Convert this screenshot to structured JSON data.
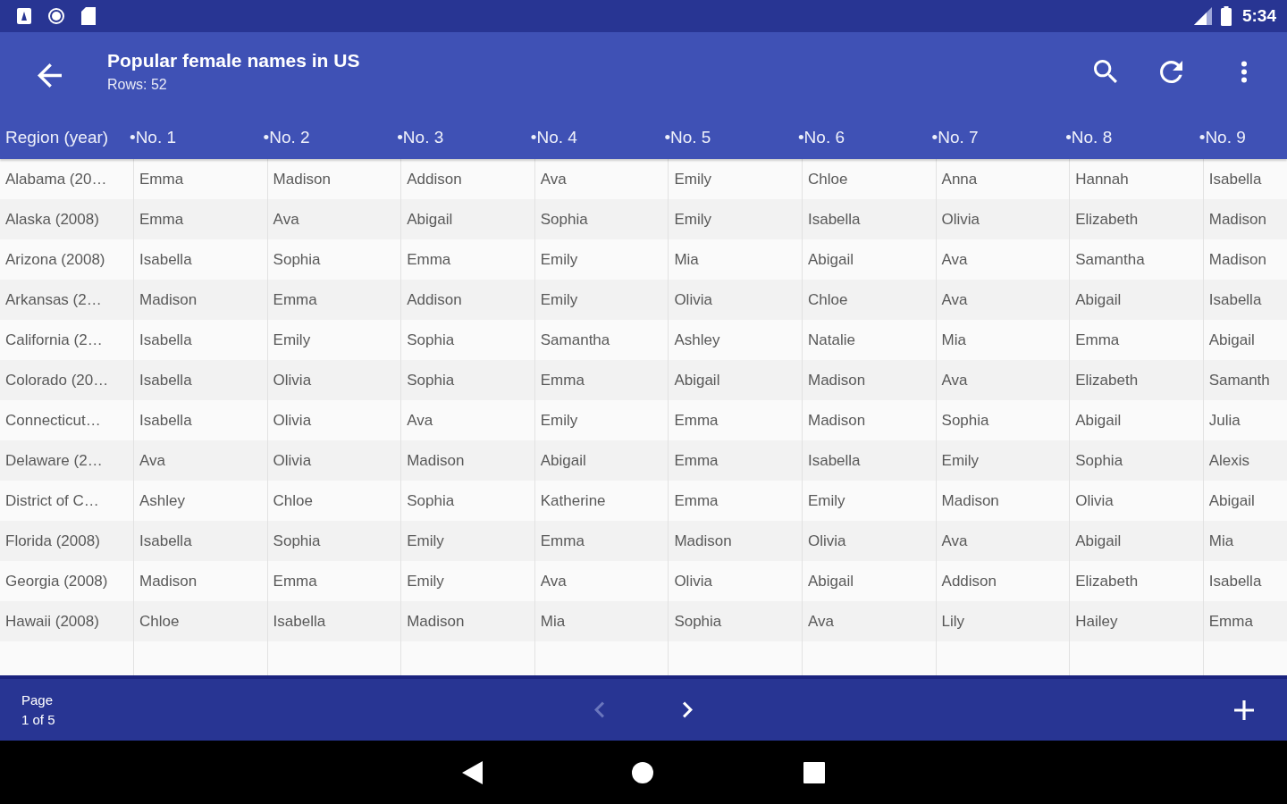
{
  "status_bar": {
    "time": "5:34"
  },
  "app_bar": {
    "title": "Popular female names in US",
    "subtitle": "Rows: 52"
  },
  "table": {
    "columns": [
      "Region (year)",
      "•No. 1",
      "•No. 2",
      "•No. 3",
      "•No. 4",
      "•No. 5",
      "•No. 6",
      "•No. 7",
      "•No. 8",
      "•No. 9"
    ],
    "rows": [
      [
        "Alabama (20…",
        "Emma",
        "Madison",
        "Addison",
        "Ava",
        "Emily",
        "Chloe",
        "Anna",
        "Hannah",
        "Isabella"
      ],
      [
        "Alaska (2008)",
        "Emma",
        "Ava",
        "Abigail",
        "Sophia",
        "Emily",
        "Isabella",
        "Olivia",
        "Elizabeth",
        "Madison"
      ],
      [
        "Arizona (2008)",
        "Isabella",
        "Sophia",
        "Emma",
        "Emily",
        "Mia",
        "Abigail",
        "Ava",
        "Samantha",
        "Madison"
      ],
      [
        "Arkansas (2…",
        "Madison",
        "Emma",
        "Addison",
        "Emily",
        "Olivia",
        "Chloe",
        "Ava",
        "Abigail",
        "Isabella"
      ],
      [
        "California (2…",
        "Isabella",
        "Emily",
        "Sophia",
        "Samantha",
        "Ashley",
        "Natalie",
        "Mia",
        "Emma",
        "Abigail"
      ],
      [
        "Colorado (20…",
        "Isabella",
        "Olivia",
        "Sophia",
        "Emma",
        "Abigail",
        "Madison",
        "Ava",
        "Elizabeth",
        "Samanth"
      ],
      [
        "Connecticut…",
        "Isabella",
        "Olivia",
        "Ava",
        "Emily",
        "Emma",
        "Madison",
        "Sophia",
        "Abigail",
        "Julia"
      ],
      [
        "Delaware (2…",
        "Ava",
        "Olivia",
        "Madison",
        "Abigail",
        "Emma",
        "Isabella",
        "Emily",
        "Sophia",
        "Alexis"
      ],
      [
        "District of C…",
        "Ashley",
        "Chloe",
        "Sophia",
        "Katherine",
        "Emma",
        "Emily",
        "Madison",
        "Olivia",
        "Abigail"
      ],
      [
        "Florida (2008)",
        "Isabella",
        "Sophia",
        "Emily",
        "Emma",
        "Madison",
        "Olivia",
        "Ava",
        "Abigail",
        "Mia"
      ],
      [
        "Georgia (2008)",
        "Madison",
        "Emma",
        "Emily",
        "Ava",
        "Olivia",
        "Abigail",
        "Addison",
        "Elizabeth",
        "Isabella"
      ],
      [
        "Hawaii (2008)",
        "Chloe",
        "Isabella",
        "Madison",
        "Mia",
        "Sophia",
        "Ava",
        "Lily",
        "Hailey",
        "Emma"
      ]
    ]
  },
  "footer": {
    "page_label": "Page",
    "page_value": "1 of 5",
    "prev": {
      "disabled": true
    },
    "next": {
      "disabled": false
    }
  }
}
